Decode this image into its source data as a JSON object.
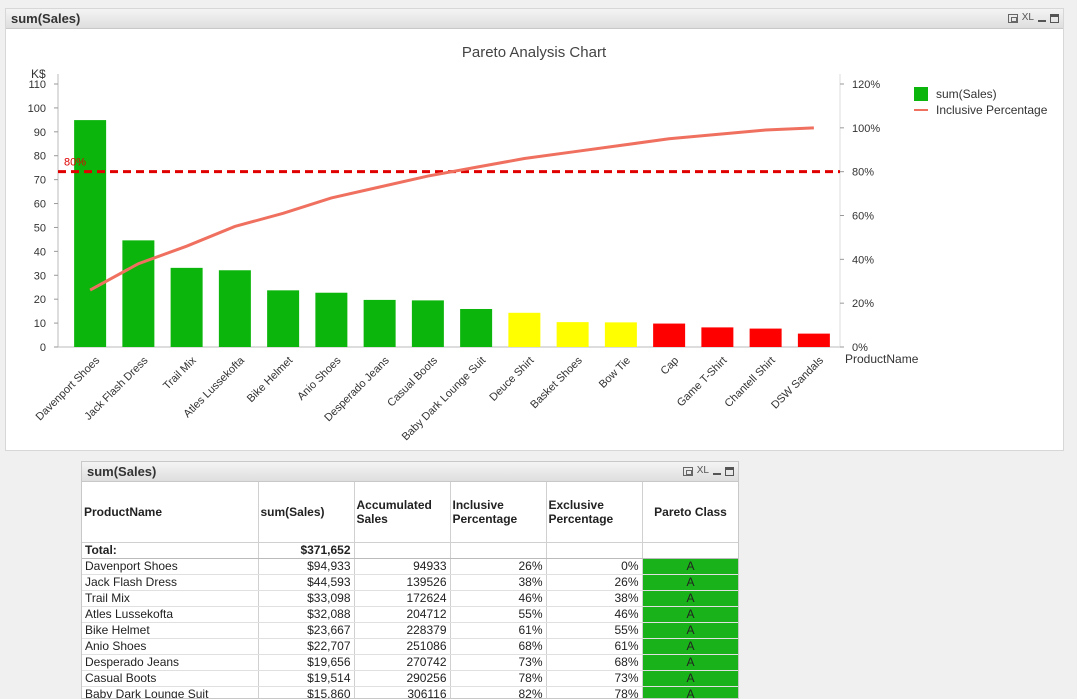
{
  "chart_window": {
    "title": "sum(Sales)",
    "ctrl_xl": "XL"
  },
  "table_window": {
    "title": "sum(Sales)",
    "ctrl_xl": "XL"
  },
  "colors": {
    "green": "#0cb50c",
    "yellow": "#ffff00",
    "red": "#ff0000",
    "line": "#f07060",
    "threshold": "#e00000"
  },
  "chart_data": {
    "type": "bar",
    "title": "Pareto Analysis Chart",
    "ylabel": "K$",
    "xlabel": "ProductName",
    "ylim": [
      0,
      110
    ],
    "yticks": [
      0,
      10,
      20,
      30,
      40,
      50,
      60,
      70,
      80,
      90,
      100,
      110
    ],
    "y2lim": [
      0,
      120
    ],
    "y2ticks": [
      "0%",
      "20%",
      "40%",
      "60%",
      "80%",
      "100%",
      "120%"
    ],
    "threshold": {
      "value": 80,
      "label": "80%"
    },
    "categories": [
      "Davenport Shoes",
      "Jack Flash Dress",
      "Trail Mix",
      "Atles Lussekofta",
      "Bike Helmet",
      "Anio Shoes",
      "Desperado Jeans",
      "Casual Boots",
      "Baby Dark Lounge Suit",
      "Deuce Shirt",
      "Basket Shoes",
      "Bow Tie",
      "Cap",
      "Game T-Shirt",
      "Chantell Shirt",
      "DSW Sandals"
    ],
    "series": [
      {
        "name": "sum(Sales)",
        "values": [
          94.9,
          44.6,
          33.1,
          32.1,
          23.7,
          22.7,
          19.7,
          19.5,
          15.9,
          14.3,
          10.4,
          10.3,
          9.8,
          8.2,
          7.7,
          5.6
        ],
        "classes": [
          "A",
          "A",
          "A",
          "A",
          "A",
          "A",
          "A",
          "A",
          "A",
          "B",
          "B",
          "B",
          "C",
          "C",
          "C",
          "C"
        ]
      },
      {
        "name": "Inclusive Percentage",
        "values": [
          26,
          38,
          46,
          55,
          61,
          68,
          73,
          78,
          82,
          86,
          89,
          92,
          95,
          97,
          99,
          100
        ]
      }
    ],
    "legend": "top-right"
  },
  "table": {
    "headers": [
      "ProductName",
      "sum(Sales)",
      "Accumulated Sales",
      "Inclusive Percentage",
      "Exclusive Percentage",
      "Pareto Class"
    ],
    "total_label": "Total:",
    "total_value": "$371,652",
    "rows": [
      [
        "Davenport Shoes",
        "$94,933",
        "94933",
        "26%",
        "0%",
        "A"
      ],
      [
        "Jack Flash Dress",
        "$44,593",
        "139526",
        "38%",
        "26%",
        "A"
      ],
      [
        "Trail Mix",
        "$33,098",
        "172624",
        "46%",
        "38%",
        "A"
      ],
      [
        "Atles Lussekofta",
        "$32,088",
        "204712",
        "55%",
        "46%",
        "A"
      ],
      [
        "Bike Helmet",
        "$23,667",
        "228379",
        "61%",
        "55%",
        "A"
      ],
      [
        "Anio Shoes",
        "$22,707",
        "251086",
        "68%",
        "61%",
        "A"
      ],
      [
        "Desperado Jeans",
        "$19,656",
        "270742",
        "73%",
        "68%",
        "A"
      ],
      [
        "Casual Boots",
        "$19,514",
        "290256",
        "78%",
        "73%",
        "A"
      ],
      [
        "Baby Dark Lounge Suit",
        "$15,860",
        "306116",
        "82%",
        "78%",
        "A"
      ]
    ]
  }
}
